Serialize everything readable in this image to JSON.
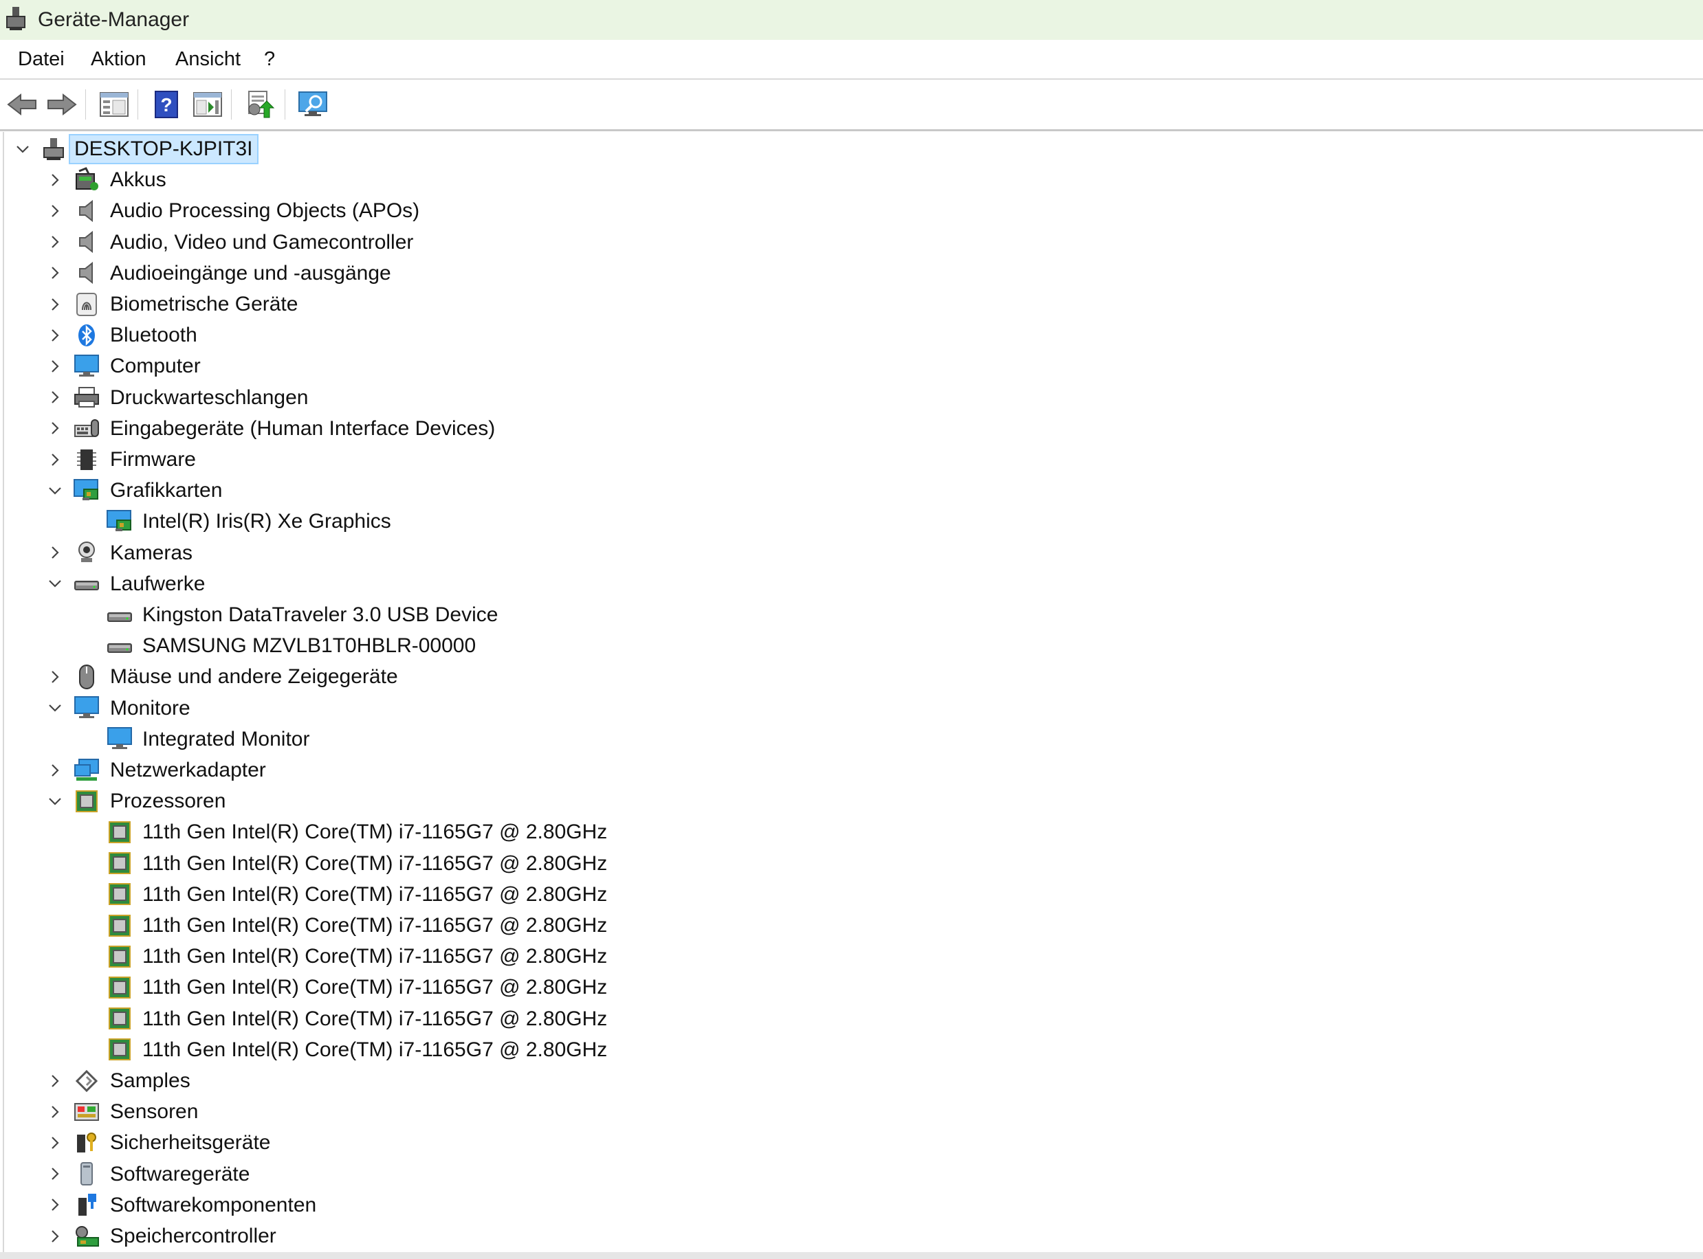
{
  "window": {
    "title": "Geräte-Manager"
  },
  "menu": {
    "items": [
      "Datei",
      "Aktion",
      "Ansicht",
      "?"
    ]
  },
  "toolbar": {
    "buttons": [
      "back-arrow-icon",
      "forward-arrow-icon",
      "show-hide-tree-icon",
      "help-icon",
      "properties-icon",
      "update-driver-icon",
      "scan-hardware-icon"
    ]
  },
  "tree": {
    "root": "DESKTOP-KJPIT3I",
    "items": [
      {
        "label": "Akkus",
        "state": "collapsed",
        "icon": "battery-icon",
        "children": []
      },
      {
        "label": "Audio Processing Objects (APOs)",
        "state": "collapsed",
        "icon": "speaker-icon",
        "children": []
      },
      {
        "label": "Audio, Video und Gamecontroller",
        "state": "collapsed",
        "icon": "speaker-icon",
        "children": []
      },
      {
        "label": "Audioeingänge und -ausgänge",
        "state": "collapsed",
        "icon": "speaker-icon",
        "children": []
      },
      {
        "label": "Biometrische Geräte",
        "state": "collapsed",
        "icon": "fingerprint-icon",
        "children": []
      },
      {
        "label": "Bluetooth",
        "state": "collapsed",
        "icon": "bluetooth-icon",
        "children": []
      },
      {
        "label": "Computer",
        "state": "collapsed",
        "icon": "computer-icon",
        "children": []
      },
      {
        "label": "Druckwarteschlangen",
        "state": "collapsed",
        "icon": "printer-icon",
        "children": []
      },
      {
        "label": "Eingabegeräte (Human Interface Devices)",
        "state": "collapsed",
        "icon": "hid-icon",
        "children": []
      },
      {
        "label": "Firmware",
        "state": "collapsed",
        "icon": "firmware-chip-icon",
        "children": []
      },
      {
        "label": "Grafikkarten",
        "state": "expanded",
        "icon": "display-adapter-icon",
        "children": [
          {
            "label": "Intel(R) Iris(R) Xe Graphics",
            "icon": "display-adapter-icon"
          }
        ]
      },
      {
        "label": "Kameras",
        "state": "collapsed",
        "icon": "camera-icon",
        "children": []
      },
      {
        "label": "Laufwerke",
        "state": "expanded",
        "icon": "drive-icon",
        "children": [
          {
            "label": "Kingston DataTraveler 3.0 USB Device",
            "icon": "drive-icon"
          },
          {
            "label": "SAMSUNG MZVLB1T0HBLR-00000",
            "icon": "drive-icon"
          }
        ]
      },
      {
        "label": "Mäuse und andere Zeigegeräte",
        "state": "collapsed",
        "icon": "mouse-icon",
        "children": []
      },
      {
        "label": "Monitore",
        "state": "expanded",
        "icon": "monitor-icon",
        "children": [
          {
            "label": "Integrated Monitor",
            "icon": "monitor-icon"
          }
        ]
      },
      {
        "label": "Netzwerkadapter",
        "state": "collapsed",
        "icon": "network-adapter-icon",
        "children": []
      },
      {
        "label": "Prozessoren",
        "state": "expanded",
        "icon": "processor-icon",
        "children": [
          {
            "label": "11th Gen Intel(R) Core(TM) i7-1165G7 @ 2.80GHz",
            "icon": "processor-icon"
          },
          {
            "label": "11th Gen Intel(R) Core(TM) i7-1165G7 @ 2.80GHz",
            "icon": "processor-icon"
          },
          {
            "label": "11th Gen Intel(R) Core(TM) i7-1165G7 @ 2.80GHz",
            "icon": "processor-icon"
          },
          {
            "label": "11th Gen Intel(R) Core(TM) i7-1165G7 @ 2.80GHz",
            "icon": "processor-icon"
          },
          {
            "label": "11th Gen Intel(R) Core(TM) i7-1165G7 @ 2.80GHz",
            "icon": "processor-icon"
          },
          {
            "label": "11th Gen Intel(R) Core(TM) i7-1165G7 @ 2.80GHz",
            "icon": "processor-icon"
          },
          {
            "label": "11th Gen Intel(R) Core(TM) i7-1165G7 @ 2.80GHz",
            "icon": "processor-icon"
          },
          {
            "label": "11th Gen Intel(R) Core(TM) i7-1165G7 @ 2.80GHz",
            "icon": "processor-icon"
          }
        ]
      },
      {
        "label": "Samples",
        "state": "collapsed",
        "icon": "samples-icon",
        "children": []
      },
      {
        "label": "Sensoren",
        "state": "collapsed",
        "icon": "sensor-icon",
        "children": []
      },
      {
        "label": "Sicherheitsgeräte",
        "state": "collapsed",
        "icon": "security-key-icon",
        "children": []
      },
      {
        "label": "Softwaregeräte",
        "state": "collapsed",
        "icon": "software-device-icon",
        "children": []
      },
      {
        "label": "Softwarekomponenten",
        "state": "collapsed",
        "icon": "software-component-icon",
        "children": []
      },
      {
        "label": "Speichercontroller",
        "state": "collapsed",
        "icon": "storage-controller-icon",
        "children": []
      }
    ]
  },
  "colors": {
    "titlebar_bg": "#eaf5e3",
    "selection_bg": "#cce8ff",
    "selection_border": "#99d1ff",
    "accent_blue": "#1e90ff"
  }
}
